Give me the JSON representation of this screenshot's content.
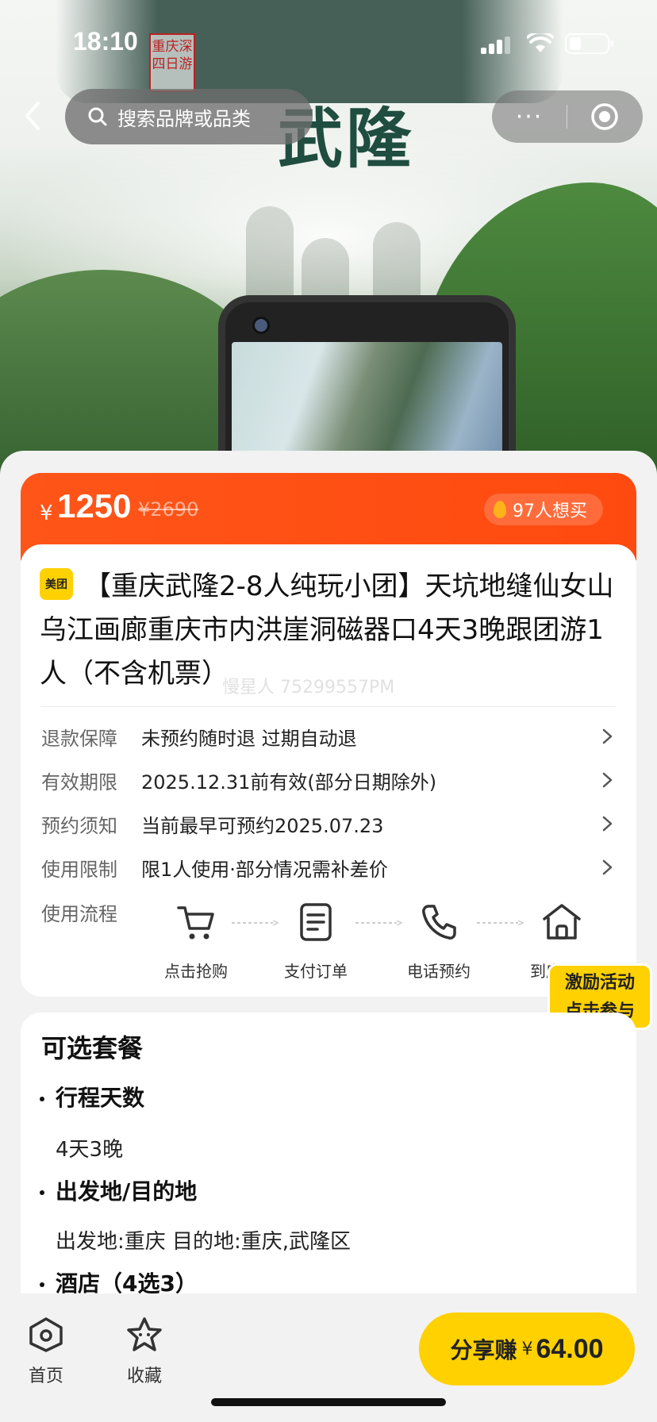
{
  "status_bar": {
    "time": "18:10"
  },
  "hero": {
    "seal_text": "重庆深\n四日游",
    "title_text": "武隆"
  },
  "nav": {
    "search_placeholder": "搜索品牌或品类",
    "more_label": "···"
  },
  "price": {
    "currency": "¥",
    "current": "1250",
    "original": "¥2690",
    "want_count": "97人想买"
  },
  "product": {
    "brand_badge": "美团",
    "title": "【重庆武隆2-8人纯玩小团】天坑地缝仙女山乌江画廊重庆市内洪崖洞磁器口4天3晚跟团游1人（不含机票）",
    "watermark": "慢星人 75299557PM"
  },
  "details": [
    {
      "key": "退款保障",
      "value": "未预约随时退 过期自动退"
    },
    {
      "key": "有效期限",
      "value": "2025.12.31前有效(部分日期除外)"
    },
    {
      "key": "预约须知",
      "value": "当前最早可预约2025.07.23"
    },
    {
      "key": "使用限制",
      "value": "限1人使用·部分情况需补差价"
    }
  ],
  "flow": {
    "label": "使用流程",
    "steps": [
      {
        "label": "点击抢购",
        "icon": "cart-icon"
      },
      {
        "label": "支付订单",
        "icon": "document-icon"
      },
      {
        "label": "电话预约",
        "icon": "phone-icon"
      },
      {
        "label": "到店使用",
        "icon": "store-icon"
      }
    ]
  },
  "promo": {
    "line1": "激励活动",
    "line2": "点击参与"
  },
  "options": {
    "title": "可选套餐",
    "groups": [
      {
        "heading": "行程天数",
        "value": "4天3晚"
      },
      {
        "heading": "出发地/目的地",
        "value": "出发地:重庆 目的地:重庆,武隆区"
      },
      {
        "heading": "酒店（4选3）",
        "value": ""
      }
    ]
  },
  "bottom_bar": {
    "home_label": "首页",
    "favorite_label": "收藏",
    "share_label": "分享赚",
    "share_currency": "¥",
    "share_amount": "64.00"
  },
  "colors": {
    "accent_orange": "#ff5519",
    "brand_yellow": "#ffd100"
  }
}
